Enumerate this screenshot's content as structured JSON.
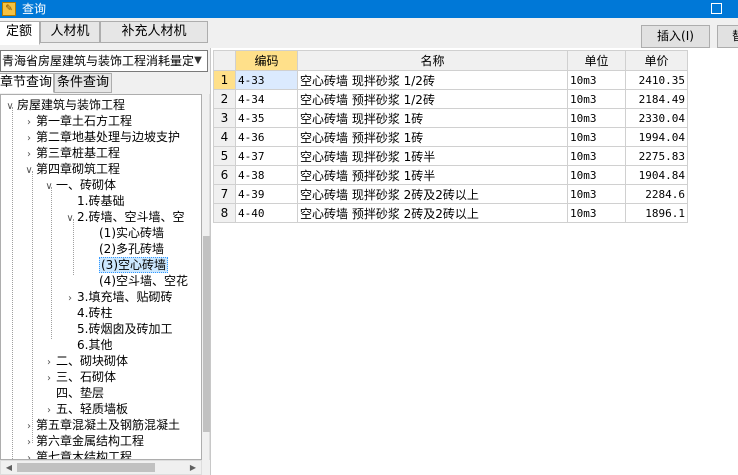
{
  "window": {
    "title": "查询"
  },
  "tabs": [
    {
      "label": "定额",
      "active": true
    },
    {
      "label": "人材机",
      "active": false
    },
    {
      "label": "补充人材机",
      "active": false
    }
  ],
  "buttons": {
    "insert": "插入(I)",
    "replace_partial": "替"
  },
  "left": {
    "combo_value": "青海省房屋建筑与装饰工程消耗量定",
    "subtabs": [
      {
        "label": "章节查询",
        "active": true
      },
      {
        "label": "条件查询",
        "active": false
      }
    ],
    "tree": [
      {
        "label": "房屋建筑与装饰工程",
        "twisty": "v"
      },
      {
        "label": "第一章土石方工程",
        "twisty": ">"
      },
      {
        "label": "第二章地基处理与边坡支护",
        "twisty": ">"
      },
      {
        "label": "第三章桩基工程",
        "twisty": ">"
      },
      {
        "label": "第四章砌筑工程",
        "twisty": "v"
      },
      {
        "label": "一、砖砌体",
        "twisty": "v"
      },
      {
        "label": "1.砖基础",
        "twisty": ""
      },
      {
        "label": "2.砖墙、空斗墙、空",
        "twisty": "v"
      },
      {
        "label": "(1)实心砖墙",
        "twisty": ""
      },
      {
        "label": "(2)多孔砖墙",
        "twisty": ""
      },
      {
        "label": "(3)空心砖墙",
        "twisty": ""
      },
      {
        "label": "(4)空斗墙、空花",
        "twisty": ""
      },
      {
        "label": "3.填充墙、贴砌砖",
        "twisty": ">"
      },
      {
        "label": "4.砖柱",
        "twisty": ""
      },
      {
        "label": "5.砖烟囱及砖加工",
        "twisty": ""
      },
      {
        "label": "6.其他",
        "twisty": ""
      },
      {
        "label": "二、砌块砌体",
        "twisty": ">"
      },
      {
        "label": "三、石砌体",
        "twisty": ">"
      },
      {
        "label": "四、垫层",
        "twisty": ""
      },
      {
        "label": "五、轻质墙板",
        "twisty": ">"
      },
      {
        "label": "第五章混凝土及钢筋混凝土",
        "twisty": ">"
      },
      {
        "label": "第六章金属结构工程",
        "twisty": ">"
      },
      {
        "label": "第七章木结构工程",
        "twisty": ">"
      }
    ]
  },
  "grid": {
    "headers": {
      "code": "编码",
      "name": "名称",
      "unit": "单位",
      "price": "单价"
    },
    "rows": [
      {
        "num": "1",
        "code": "4-33",
        "name": "空心砖墙 现拌砂浆 1/2砖",
        "unit": "10m3",
        "price": "2410.35"
      },
      {
        "num": "2",
        "code": "4-34",
        "name": "空心砖墙 预拌砂浆 1/2砖",
        "unit": "10m3",
        "price": "2184.49"
      },
      {
        "num": "3",
        "code": "4-35",
        "name": "空心砖墙 现拌砂浆 1砖",
        "unit": "10m3",
        "price": "2330.04"
      },
      {
        "num": "4",
        "code": "4-36",
        "name": "空心砖墙 预拌砂浆 1砖",
        "unit": "10m3",
        "price": "1994.04"
      },
      {
        "num": "5",
        "code": "4-37",
        "name": "空心砖墙 现拌砂浆 1砖半",
        "unit": "10m3",
        "price": "2275.83"
      },
      {
        "num": "6",
        "code": "4-38",
        "name": "空心砖墙 预拌砂浆 1砖半",
        "unit": "10m3",
        "price": "1904.84"
      },
      {
        "num": "7",
        "code": "4-39",
        "name": "空心砖墙 现拌砂浆 2砖及2砖以上",
        "unit": "10m3",
        "price": "2284.6"
      },
      {
        "num": "8",
        "code": "4-40",
        "name": "空心砖墙 预拌砂浆 2砖及2砖以上",
        "unit": "10m3",
        "price": "1896.1"
      }
    ]
  }
}
